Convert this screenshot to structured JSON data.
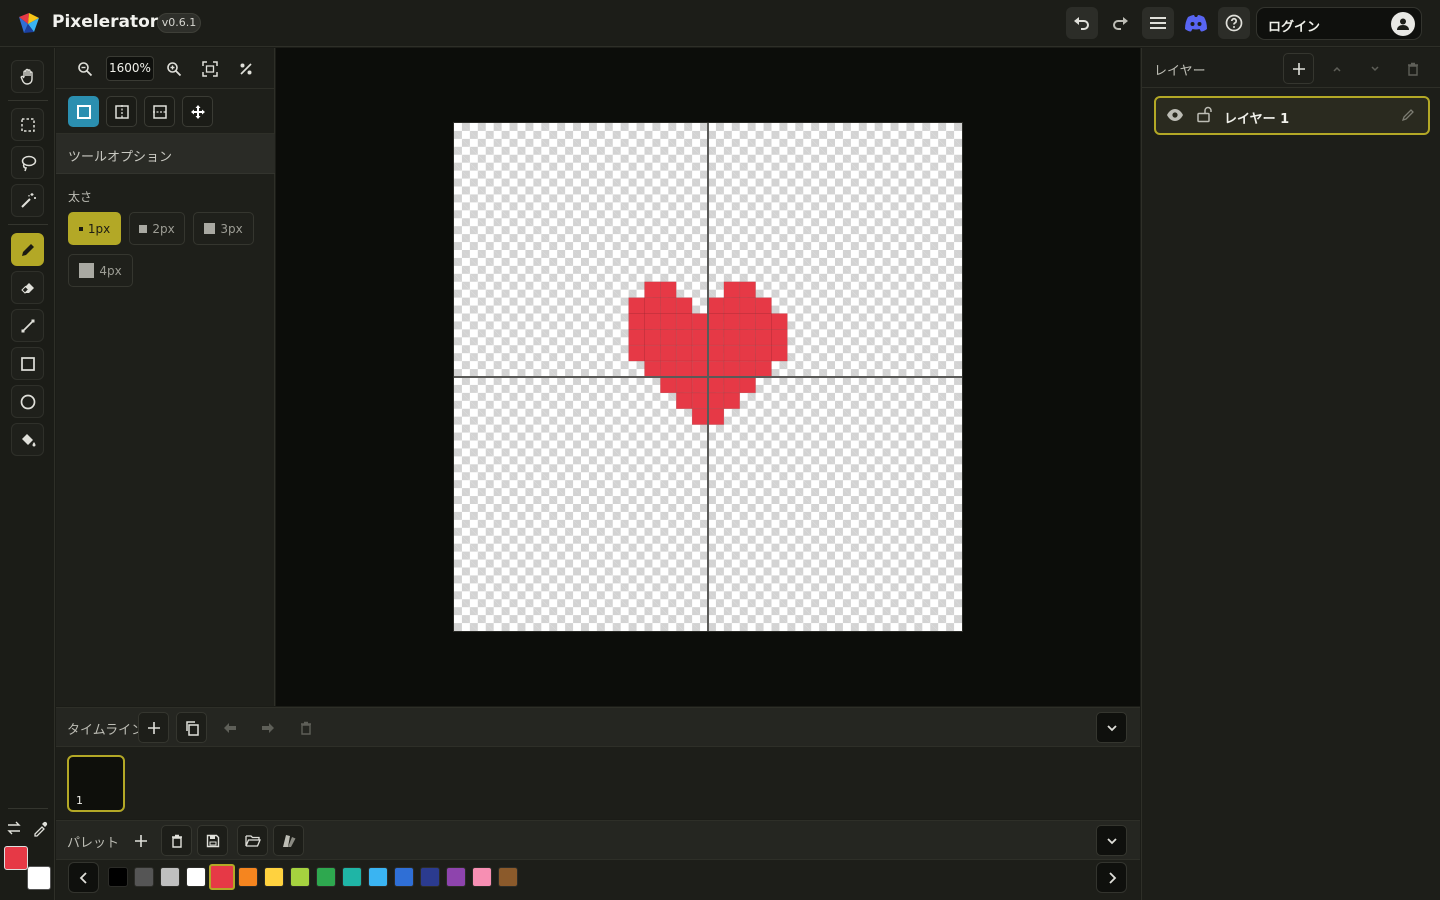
{
  "app": {
    "name": "Pixelerator",
    "version": "v0.6.1"
  },
  "header": {
    "login_label": "ログイン"
  },
  "zoom": {
    "value": "1600%"
  },
  "tool_options": {
    "title": "ツールオプション",
    "size_label": "太さ",
    "sizes": [
      "1px",
      "2px",
      "3px",
      "4px"
    ],
    "selected_size": "1px"
  },
  "layers": {
    "title": "レイヤー",
    "items": [
      {
        "name": "レイヤー 1",
        "visible": true,
        "locked": false,
        "selected": true
      }
    ]
  },
  "timeline": {
    "title": "タイムライン",
    "frames": [
      {
        "number": "1",
        "selected": true
      }
    ]
  },
  "palette": {
    "title": "パレット",
    "colors": [
      "#000000",
      "#555555",
      "#bfbfbf",
      "#ffffff",
      "#e63946",
      "#f5851f",
      "#ffd23f",
      "#a5d23f",
      "#2ea84f",
      "#1fb5a6",
      "#3ab4f2",
      "#2f6fd6",
      "#2b3b8f",
      "#8e44ad",
      "#f78fb3",
      "#8b5a2b"
    ],
    "selected_index": 4
  },
  "colors": {
    "primary": "#e63946",
    "secondary": "#ffffff",
    "accent": "#b3a826"
  },
  "tools": {
    "items": [
      "hand-icon",
      "rect-select-icon",
      "lasso-icon",
      "magic-wand-icon",
      "pencil-icon",
      "eraser-icon",
      "line-icon",
      "rectangle-icon",
      "ellipse-icon",
      "bucket-icon"
    ],
    "active": "pencil-icon"
  },
  "symmetry": {
    "active": "none"
  },
  "canvas": {
    "width": 32,
    "height": 32,
    "pixel_color": "#e63946",
    "pixels": [
      [
        12,
        10
      ],
      [
        13,
        10
      ],
      [
        17,
        10
      ],
      [
        18,
        10
      ],
      [
        11,
        11
      ],
      [
        12,
        11
      ],
      [
        13,
        11
      ],
      [
        14,
        11
      ],
      [
        16,
        11
      ],
      [
        17,
        11
      ],
      [
        18,
        11
      ],
      [
        19,
        11
      ],
      [
        11,
        12
      ],
      [
        12,
        12
      ],
      [
        13,
        12
      ],
      [
        14,
        12
      ],
      [
        15,
        12
      ],
      [
        16,
        12
      ],
      [
        17,
        12
      ],
      [
        18,
        12
      ],
      [
        19,
        12
      ],
      [
        20,
        12
      ],
      [
        11,
        13
      ],
      [
        12,
        13
      ],
      [
        13,
        13
      ],
      [
        14,
        13
      ],
      [
        15,
        13
      ],
      [
        16,
        13
      ],
      [
        17,
        13
      ],
      [
        18,
        13
      ],
      [
        19,
        13
      ],
      [
        20,
        13
      ],
      [
        11,
        14
      ],
      [
        12,
        14
      ],
      [
        13,
        14
      ],
      [
        14,
        14
      ],
      [
        15,
        14
      ],
      [
        16,
        14
      ],
      [
        17,
        14
      ],
      [
        18,
        14
      ],
      [
        19,
        14
      ],
      [
        20,
        14
      ],
      [
        12,
        15
      ],
      [
        13,
        15
      ],
      [
        14,
        15
      ],
      [
        15,
        15
      ],
      [
        16,
        15
      ],
      [
        17,
        15
      ],
      [
        18,
        15
      ],
      [
        19,
        15
      ],
      [
        13,
        16
      ],
      [
        14,
        16
      ],
      [
        15,
        16
      ],
      [
        16,
        16
      ],
      [
        17,
        16
      ],
      [
        18,
        16
      ],
      [
        14,
        17
      ],
      [
        15,
        17
      ],
      [
        16,
        17
      ],
      [
        17,
        17
      ],
      [
        15,
        18
      ],
      [
        16,
        18
      ]
    ]
  }
}
